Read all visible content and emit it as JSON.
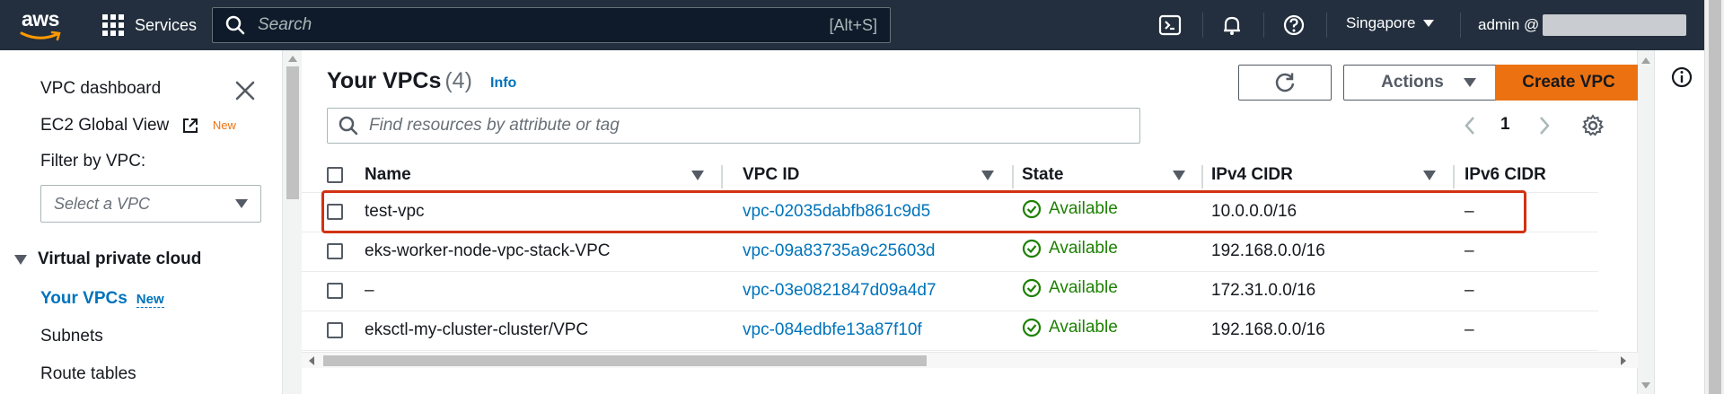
{
  "topnav": {
    "logo": "aws",
    "services_label": "Services",
    "search_placeholder": "Search",
    "search_shortcut": "[Alt+S]",
    "icons": [
      "cloudshell-icon",
      "bell-icon",
      "help-icon"
    ],
    "region": "Singapore",
    "account": "admin @"
  },
  "sidebar": {
    "vpc_dashboard": "VPC dashboard",
    "ec2_global_view": "EC2 Global View",
    "ec2_global_view_badge": "New",
    "filter_label": "Filter by VPC:",
    "filter_placeholder": "Select a VPC",
    "section_title": "Virtual private cloud",
    "items": [
      {
        "label": "Your VPCs",
        "badge": "New",
        "active": true
      },
      {
        "label": "Subnets"
      },
      {
        "label": "Route tables"
      }
    ]
  },
  "main": {
    "title": "Your VPCs",
    "count": "(4)",
    "info_link": "Info",
    "actions_label": "Actions",
    "create_label": "Create VPC",
    "filter_placeholder": "Find resources by attribute or tag",
    "page_number": "1",
    "columns": [
      "Name",
      "VPC ID",
      "State",
      "IPv4 CIDR",
      "IPv6 CIDR"
    ],
    "rows": [
      {
        "name": "test-vpc",
        "vpc_id": "vpc-02035dabfb861c9d5",
        "state": "Available",
        "ipv4": "10.0.0.0/16",
        "ipv6": "–",
        "highlighted": true
      },
      {
        "name": "eks-worker-node-vpc-stack-VPC",
        "vpc_id": "vpc-09a83735a9c25603d",
        "state": "Available",
        "ipv4": "192.168.0.0/16",
        "ipv6": "–"
      },
      {
        "name": "–",
        "vpc_id": "vpc-03e0821847d09a4d7",
        "state": "Available",
        "ipv4": "172.31.0.0/16",
        "ipv6": "–"
      },
      {
        "name": "eksctl-my-cluster-cluster/VPC",
        "vpc_id": "vpc-084edbfe13a87f10f",
        "state": "Available",
        "ipv4": "192.168.0.0/16",
        "ipv6": "–"
      }
    ]
  },
  "colors": {
    "nav_bg": "#232f3e",
    "primary": "#ec7211",
    "link": "#0073bb",
    "success": "#1d8102",
    "highlight": "#d13212"
  }
}
